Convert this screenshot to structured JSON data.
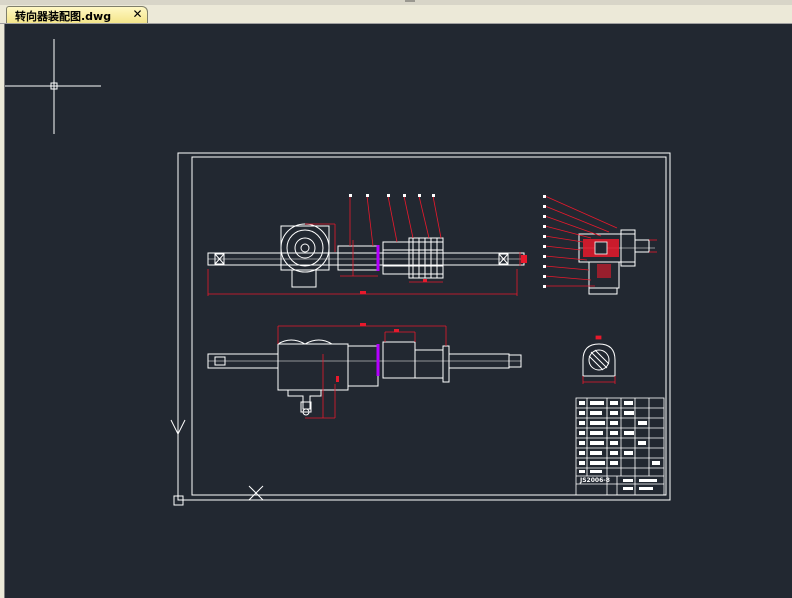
{
  "tabs": [
    {
      "label": "转向器装配图.dwg",
      "active": true
    }
  ],
  "tab_close_glyph": "✕",
  "title_block": {
    "drawing_code": "JS2006-8"
  },
  "colors": {
    "canvas_bg": "#222831",
    "line_white": "#ffffff",
    "dimension_red": "#e8192c",
    "accent_magenta": "#b400ff",
    "tab_bg": "#f4e58a"
  },
  "icons": {
    "crosshair": "crosshair-cursor-icon",
    "ucs": "ucs-icon",
    "close": "close-icon"
  }
}
